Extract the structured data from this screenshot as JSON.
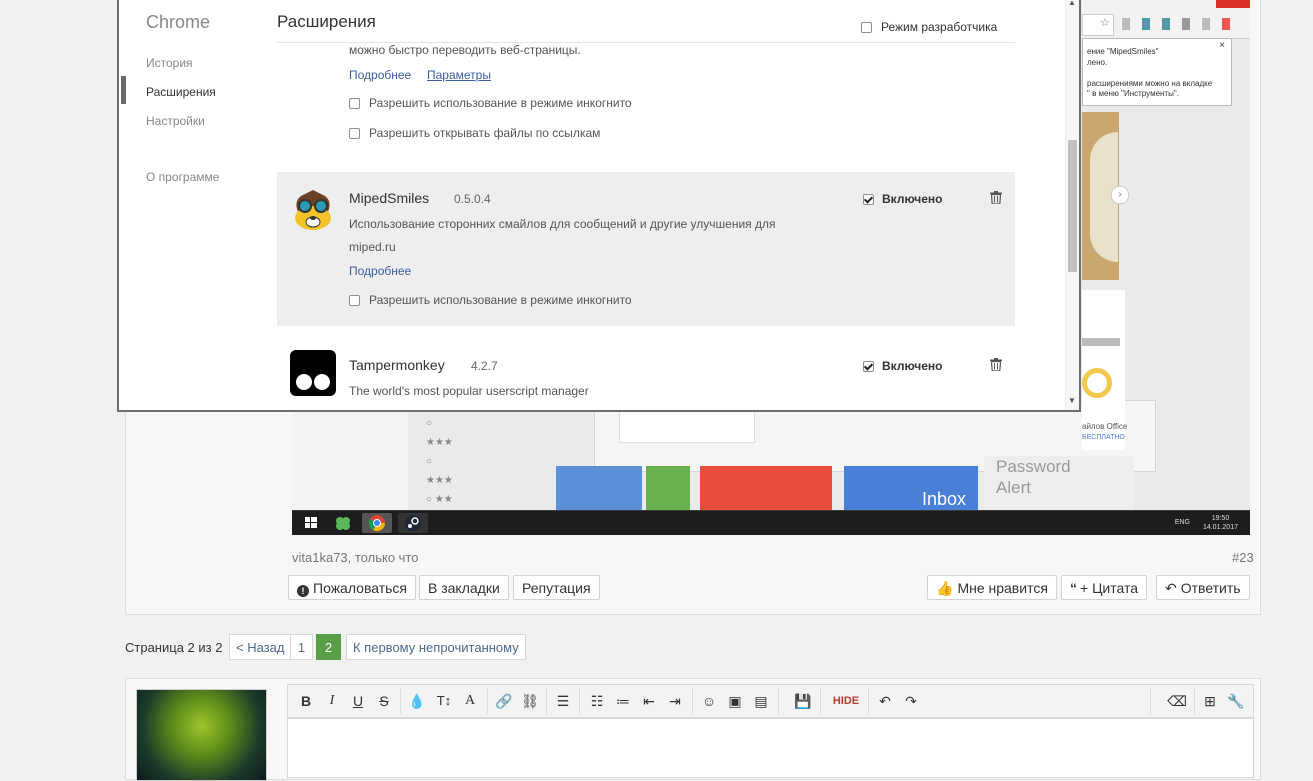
{
  "chrome_window": {
    "nav_title": "Chrome",
    "nav_items": [
      "История",
      "Расширения",
      "Настройки"
    ],
    "nav_about": "О программе",
    "page_title": "Расширения",
    "developer_mode": "Режим разработчика",
    "first_ext": {
      "desc_line": "можно быстро переводить веб-страницы.",
      "details": "Подробнее",
      "params": "Параметры",
      "incognito": "Разрешить использование в режиме инкогнито",
      "file_urls": "Разрешить открывать файлы по ссылкам"
    },
    "ext_miped": {
      "name": "MipedSmiles",
      "version": "0.5.0.4",
      "desc1": "Использование сторонних смайлов для сообщений и другие улучшения для",
      "desc2": "miped.ru",
      "details": "Подробнее",
      "incognito": "Разрешить использование в режиме инкогнито",
      "enabled_label": "Включено"
    },
    "ext_tamper": {
      "name": "Tampermonkey",
      "version": "4.2.7",
      "desc": "The world's most popular userscript manager",
      "enabled_label": "Включено"
    }
  },
  "background_screenshot": {
    "popup_line1": "ение \"MipedSmiles\"",
    "popup_line2": "лено.",
    "popup_line3": "расширениями можно на вкладке",
    "popup_line4": "\" в меню \"Инструменты\".",
    "tile_inbox": "Inbox",
    "tile_password": "Password",
    "tile_alert": "Alert",
    "office_text": "айлов Office",
    "office_free": "БЕСПЛАТНО",
    "tray_lang": "ENG",
    "tray_time": "19:50",
    "tray_date": "14.01.2017"
  },
  "post": {
    "meta": "vita1ka73, только что",
    "number": "#23",
    "report": "Пожаловаться",
    "bookmark": "В закладки",
    "reputation": "Репутация",
    "like": "Мне нравится",
    "quote": "+ Цитата",
    "reply": "Ответить"
  },
  "pagination": {
    "label": "Страница 2 из 2",
    "prev": "< Назад",
    "page1": "1",
    "page2": "2",
    "first_unread": "К первому непрочитанному"
  },
  "editor": {
    "hide_label": "HIDE"
  }
}
